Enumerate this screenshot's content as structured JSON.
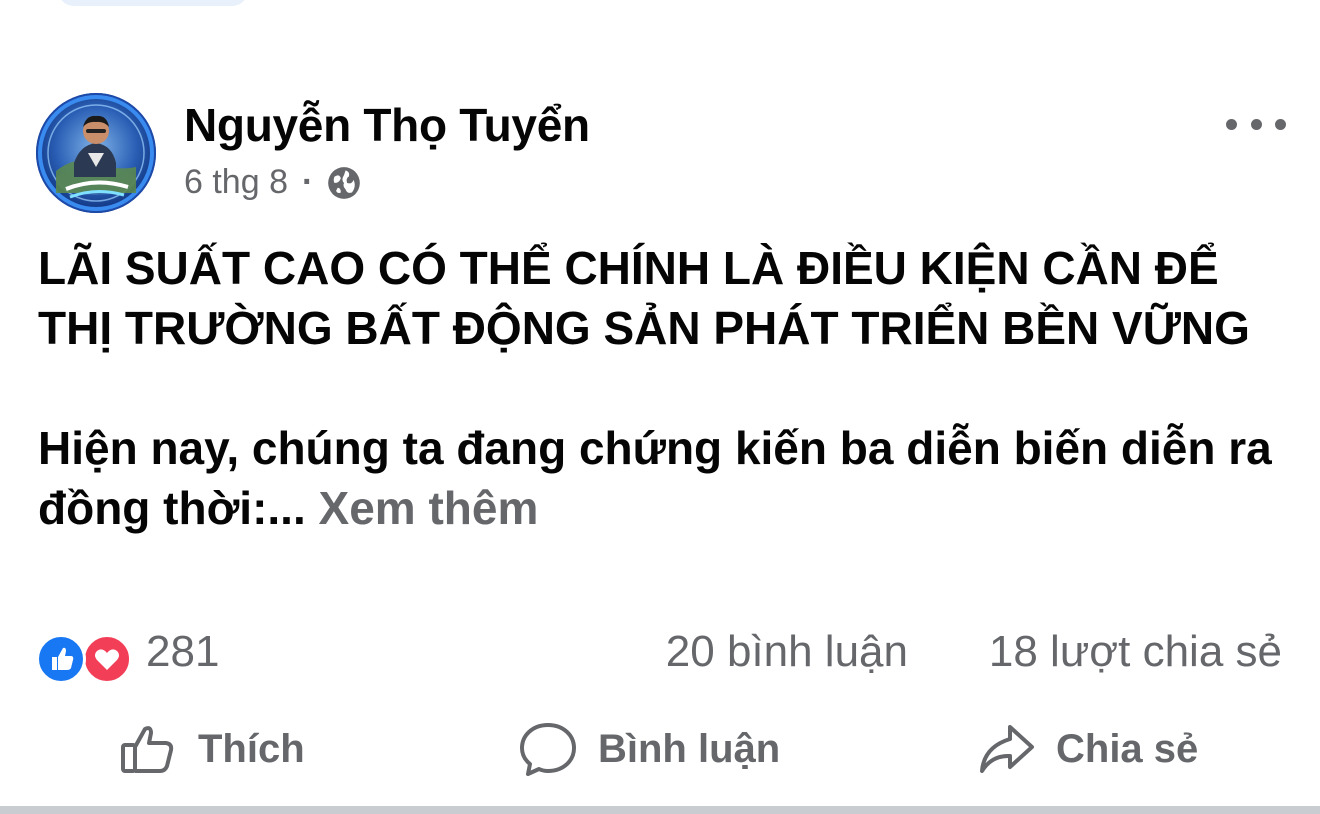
{
  "post": {
    "author": "Nguyễn Thọ Tuyển",
    "date": "6 thg 8",
    "separator": "·",
    "privacy_icon": "globe-icon",
    "title": "LÃI SUẤT CAO CÓ THỂ CHÍNH LÀ ĐIỀU KIỆN CẦN ĐỂ THỊ TRƯỜNG BẤT ĐỘNG SẢN PHÁT TRIỂN BỀN VỮNG",
    "paragraph": "Hiện nay, chúng ta đang chứng kiến ba diễn biến diễn ra đồng thời:... ",
    "see_more": "Xem thêm"
  },
  "stats": {
    "reaction_icons": [
      "like-icon",
      "love-icon"
    ],
    "reaction_count": "281",
    "comments": "20 bình luận",
    "shares": "18 lượt chia sẻ"
  },
  "actions": {
    "like": "Thích",
    "comment": "Bình luận",
    "share": "Chia sẻ"
  },
  "colors": {
    "text_primary": "#050505",
    "text_secondary": "#65676b",
    "like_blue": "#1877f2",
    "love_red": "#f33e58",
    "divider": "#c9ccd1"
  }
}
